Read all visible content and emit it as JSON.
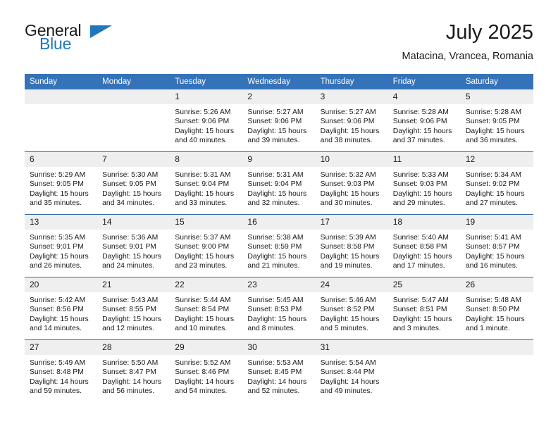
{
  "logo": {
    "word_top": "General",
    "word_bottom": "Blue",
    "accent_color": "#1f77bd",
    "triangle_icon": "triangle-icon"
  },
  "header": {
    "title": "July 2025",
    "subtitle": "Matacina, Vrancea, Romania"
  },
  "theme": {
    "header_row_bg": "#3573b9",
    "header_row_text": "#ffffff",
    "daynum_bg": "#efefef",
    "row_divider": "#2e6da8",
    "body_text": "#1a1a1a"
  },
  "weekday_headers": [
    "Sunday",
    "Monday",
    "Tuesday",
    "Wednesday",
    "Thursday",
    "Friday",
    "Saturday"
  ],
  "weeks": [
    [
      {
        "day": "",
        "blank": true,
        "sunrise": "",
        "sunset": "",
        "daylight": ""
      },
      {
        "day": "",
        "blank": true,
        "sunrise": "",
        "sunset": "",
        "daylight": ""
      },
      {
        "day": "1",
        "sunrise": "Sunrise: 5:26 AM",
        "sunset": "Sunset: 9:06 PM",
        "daylight": "Daylight: 15 hours and 40 minutes."
      },
      {
        "day": "2",
        "sunrise": "Sunrise: 5:27 AM",
        "sunset": "Sunset: 9:06 PM",
        "daylight": "Daylight: 15 hours and 39 minutes."
      },
      {
        "day": "3",
        "sunrise": "Sunrise: 5:27 AM",
        "sunset": "Sunset: 9:06 PM",
        "daylight": "Daylight: 15 hours and 38 minutes."
      },
      {
        "day": "4",
        "sunrise": "Sunrise: 5:28 AM",
        "sunset": "Sunset: 9:06 PM",
        "daylight": "Daylight: 15 hours and 37 minutes."
      },
      {
        "day": "5",
        "sunrise": "Sunrise: 5:28 AM",
        "sunset": "Sunset: 9:05 PM",
        "daylight": "Daylight: 15 hours and 36 minutes."
      }
    ],
    [
      {
        "day": "6",
        "sunrise": "Sunrise: 5:29 AM",
        "sunset": "Sunset: 9:05 PM",
        "daylight": "Daylight: 15 hours and 35 minutes."
      },
      {
        "day": "7",
        "sunrise": "Sunrise: 5:30 AM",
        "sunset": "Sunset: 9:05 PM",
        "daylight": "Daylight: 15 hours and 34 minutes."
      },
      {
        "day": "8",
        "sunrise": "Sunrise: 5:31 AM",
        "sunset": "Sunset: 9:04 PM",
        "daylight": "Daylight: 15 hours and 33 minutes."
      },
      {
        "day": "9",
        "sunrise": "Sunrise: 5:31 AM",
        "sunset": "Sunset: 9:04 PM",
        "daylight": "Daylight: 15 hours and 32 minutes."
      },
      {
        "day": "10",
        "sunrise": "Sunrise: 5:32 AM",
        "sunset": "Sunset: 9:03 PM",
        "daylight": "Daylight: 15 hours and 30 minutes."
      },
      {
        "day": "11",
        "sunrise": "Sunrise: 5:33 AM",
        "sunset": "Sunset: 9:03 PM",
        "daylight": "Daylight: 15 hours and 29 minutes."
      },
      {
        "day": "12",
        "sunrise": "Sunrise: 5:34 AM",
        "sunset": "Sunset: 9:02 PM",
        "daylight": "Daylight: 15 hours and 27 minutes."
      }
    ],
    [
      {
        "day": "13",
        "sunrise": "Sunrise: 5:35 AM",
        "sunset": "Sunset: 9:01 PM",
        "daylight": "Daylight: 15 hours and 26 minutes."
      },
      {
        "day": "14",
        "sunrise": "Sunrise: 5:36 AM",
        "sunset": "Sunset: 9:01 PM",
        "daylight": "Daylight: 15 hours and 24 minutes."
      },
      {
        "day": "15",
        "sunrise": "Sunrise: 5:37 AM",
        "sunset": "Sunset: 9:00 PM",
        "daylight": "Daylight: 15 hours and 23 minutes."
      },
      {
        "day": "16",
        "sunrise": "Sunrise: 5:38 AM",
        "sunset": "Sunset: 8:59 PM",
        "daylight": "Daylight: 15 hours and 21 minutes."
      },
      {
        "day": "17",
        "sunrise": "Sunrise: 5:39 AM",
        "sunset": "Sunset: 8:58 PM",
        "daylight": "Daylight: 15 hours and 19 minutes."
      },
      {
        "day": "18",
        "sunrise": "Sunrise: 5:40 AM",
        "sunset": "Sunset: 8:58 PM",
        "daylight": "Daylight: 15 hours and 17 minutes."
      },
      {
        "day": "19",
        "sunrise": "Sunrise: 5:41 AM",
        "sunset": "Sunset: 8:57 PM",
        "daylight": "Daylight: 15 hours and 16 minutes."
      }
    ],
    [
      {
        "day": "20",
        "sunrise": "Sunrise: 5:42 AM",
        "sunset": "Sunset: 8:56 PM",
        "daylight": "Daylight: 15 hours and 14 minutes."
      },
      {
        "day": "21",
        "sunrise": "Sunrise: 5:43 AM",
        "sunset": "Sunset: 8:55 PM",
        "daylight": "Daylight: 15 hours and 12 minutes."
      },
      {
        "day": "22",
        "sunrise": "Sunrise: 5:44 AM",
        "sunset": "Sunset: 8:54 PM",
        "daylight": "Daylight: 15 hours and 10 minutes."
      },
      {
        "day": "23",
        "sunrise": "Sunrise: 5:45 AM",
        "sunset": "Sunset: 8:53 PM",
        "daylight": "Daylight: 15 hours and 8 minutes."
      },
      {
        "day": "24",
        "sunrise": "Sunrise: 5:46 AM",
        "sunset": "Sunset: 8:52 PM",
        "daylight": "Daylight: 15 hours and 5 minutes."
      },
      {
        "day": "25",
        "sunrise": "Sunrise: 5:47 AM",
        "sunset": "Sunset: 8:51 PM",
        "daylight": "Daylight: 15 hours and 3 minutes."
      },
      {
        "day": "26",
        "sunrise": "Sunrise: 5:48 AM",
        "sunset": "Sunset: 8:50 PM",
        "daylight": "Daylight: 15 hours and 1 minute."
      }
    ],
    [
      {
        "day": "27",
        "sunrise": "Sunrise: 5:49 AM",
        "sunset": "Sunset: 8:48 PM",
        "daylight": "Daylight: 14 hours and 59 minutes."
      },
      {
        "day": "28",
        "sunrise": "Sunrise: 5:50 AM",
        "sunset": "Sunset: 8:47 PM",
        "daylight": "Daylight: 14 hours and 56 minutes."
      },
      {
        "day": "29",
        "sunrise": "Sunrise: 5:52 AM",
        "sunset": "Sunset: 8:46 PM",
        "daylight": "Daylight: 14 hours and 54 minutes."
      },
      {
        "day": "30",
        "sunrise": "Sunrise: 5:53 AM",
        "sunset": "Sunset: 8:45 PM",
        "daylight": "Daylight: 14 hours and 52 minutes."
      },
      {
        "day": "31",
        "sunrise": "Sunrise: 5:54 AM",
        "sunset": "Sunset: 8:44 PM",
        "daylight": "Daylight: 14 hours and 49 minutes."
      },
      {
        "day": "",
        "blank": true,
        "sunrise": "",
        "sunset": "",
        "daylight": ""
      },
      {
        "day": "",
        "blank": true,
        "sunrise": "",
        "sunset": "",
        "daylight": ""
      }
    ]
  ]
}
